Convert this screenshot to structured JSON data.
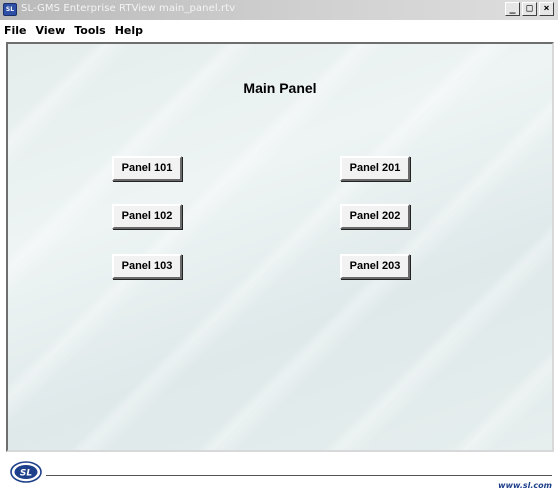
{
  "window": {
    "icon_text": "SL",
    "title": "SL-GMS Enterprise RTView main_panel.rtv",
    "minimize_glyph": "_",
    "maximize_glyph": "□",
    "close_glyph": "×"
  },
  "menu": {
    "items": [
      {
        "label": "File"
      },
      {
        "label": "View"
      },
      {
        "label": "Tools"
      },
      {
        "label": "Help"
      }
    ]
  },
  "display": {
    "title": "Main Panel",
    "buttons": [
      {
        "label": "Panel 101"
      },
      {
        "label": "Panel 201"
      },
      {
        "label": "Panel 102"
      },
      {
        "label": "Panel 202"
      },
      {
        "label": "Panel 103"
      },
      {
        "label": "Panel 203"
      }
    ]
  },
  "footer": {
    "logo_text": "SL",
    "url": "www.sl.com"
  },
  "colors": {
    "title_bar": "#c4c4c4",
    "display_background": "#e6eeee",
    "logo_blue": "#1e3f8a"
  }
}
